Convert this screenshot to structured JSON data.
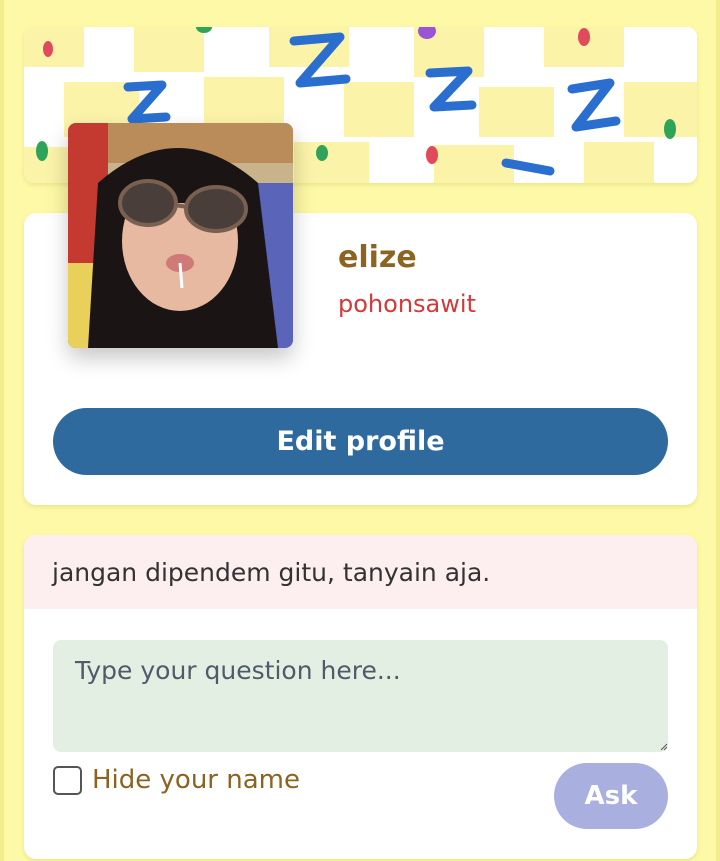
{
  "profile": {
    "display_name": "elize",
    "username": "pohonsawit",
    "edit_label": "Edit profile"
  },
  "ask": {
    "prompt": "jangan dipendem gitu, tanyain aja.",
    "placeholder": "Type your question here...",
    "hide_label": "Hide your name",
    "hide_checked": false,
    "ask_label": "Ask"
  },
  "colors": {
    "page_bg": "#fdf9a6",
    "edit_button": "#2f6a9f",
    "ask_button": "#a9b0e0",
    "name": "#8a6420",
    "username": "#d23a3a",
    "header_bg": "#fdeff0",
    "input_bg": "#e3efe3"
  },
  "icons": {
    "banner": "sleepy-zzz-pattern",
    "checkbox": "checkbox-unchecked-icon"
  }
}
